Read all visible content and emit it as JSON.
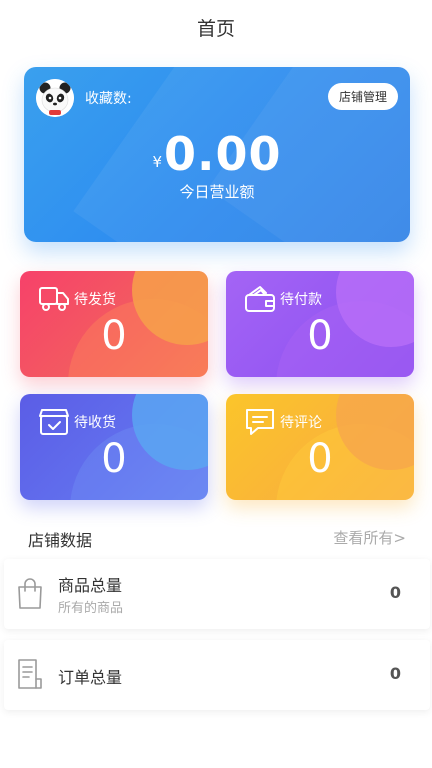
{
  "header": {
    "title": "首页"
  },
  "revenue_card": {
    "fav_label": "收藏数:",
    "store_button": "店铺管理",
    "currency": "¥",
    "amount": "0.00",
    "amount_label": "今日营业额"
  },
  "stats": [
    {
      "label": "待发货",
      "count": "0",
      "icon": "truck-icon"
    },
    {
      "label": "待付款",
      "count": "0",
      "icon": "wallet-icon"
    },
    {
      "label": "待收货",
      "count": "0",
      "icon": "box-icon"
    },
    {
      "label": "待评论",
      "count": "0",
      "icon": "comment-icon"
    }
  ],
  "store_data": {
    "title": "店铺数据",
    "view_all": "查看所有>",
    "rows": [
      {
        "title": "商品总量",
        "subtitle": "所有的商品",
        "value": "0",
        "icon": "shopping-bag-icon"
      },
      {
        "title": "订单总量",
        "value": "0",
        "icon": "receipt-icon"
      }
    ]
  },
  "colors": {
    "revenue": "#2f8ff0",
    "ship": "#f4506a",
    "pay": "#9a5af2",
    "receive": "#6270ec",
    "review": "#fabb35"
  }
}
